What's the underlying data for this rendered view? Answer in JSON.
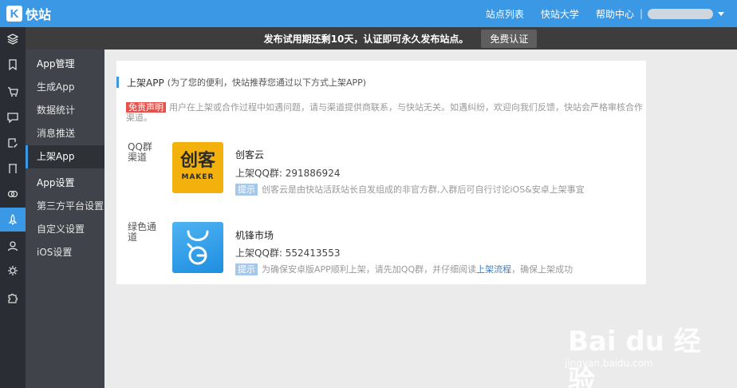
{
  "topbar": {
    "logo_letter": "K",
    "title": "快站",
    "nav": [
      "站点列表",
      "快站大学",
      "帮助中心"
    ],
    "separator": "|",
    "brand_color": "#3a98e4"
  },
  "notice": {
    "message": "发布试用期还剩10天，认证即可永久发布站点。",
    "button": "免费认证"
  },
  "rail": {
    "icons": [
      "layers-icon",
      "bookmark-icon",
      "cart-icon",
      "chat-icon",
      "edit-icon",
      "frame-icon",
      "handshake-icon",
      "rocket-icon",
      "user-icon",
      "gear-icon",
      "puzzle-icon"
    ],
    "active_index": 7
  },
  "subnav": {
    "group1": "App管理",
    "items1": [
      "生成App",
      "数据统计",
      "消息推送",
      "上架App"
    ],
    "group2": "App设置",
    "items2": [
      "第三方平台设置",
      "自定义设置",
      "iOS设置"
    ],
    "active": "上架App"
  },
  "card": {
    "title": "上架APP",
    "subtitle": "(为了您的便利，快站推荐您通过以下方式上架APP)",
    "disclaimer_tag": "免责声明",
    "disclaimer_text": "用户在上架或合作过程中如遇问题，请与渠道提供商联系，与快站无关。如遇纠纷，欢迎向我们反馈，快站会严格审核合作渠道。",
    "channels": [
      {
        "label": "QQ群渠道",
        "icon_text": "创客",
        "icon_subtext": "MAKER",
        "name": "创客云",
        "qq": "上架QQ群: 291886924",
        "tip_badge": "提示",
        "tip": "创客云是由快站活跃站长自发组成的非官方群,入群后可自行讨论iOS&安卓上架事宜"
      },
      {
        "label": "绿色通道",
        "name": "机锋市场",
        "qq": "上架QQ群: 552413553",
        "tip_badge": "提示",
        "tip_before": "为确保安卓版APP顺利上架，请先加QQ群，并仔细阅读",
        "tip_link": "上架流程",
        "tip_after": "，确保上架成功"
      }
    ]
  },
  "watermark": {
    "big": "Bai du 经验",
    "small": "jingyan.baidu.com"
  }
}
